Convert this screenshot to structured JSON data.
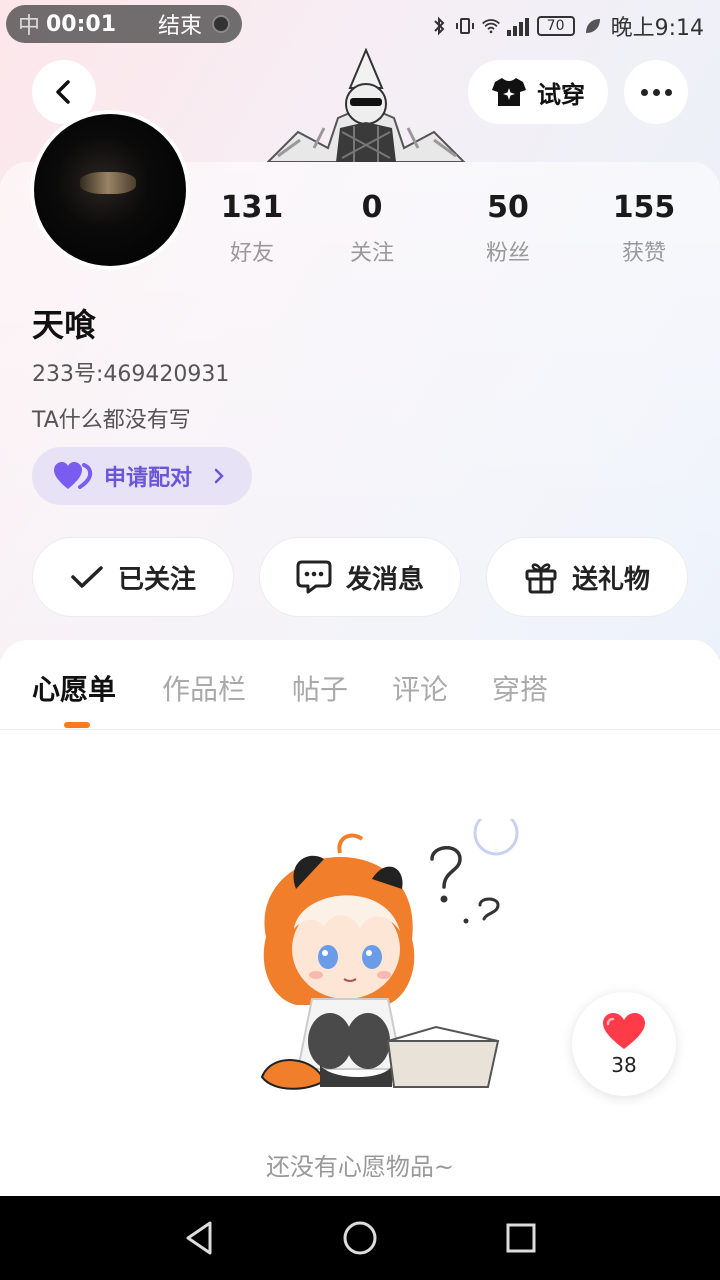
{
  "status_bar": {
    "carrier": "中",
    "rec_time": "00:01",
    "rec_end": "结束",
    "battery": "70",
    "clock": "晚上9:14"
  },
  "header": {
    "tryon_label": "试穿"
  },
  "stats": [
    {
      "value": "131",
      "label": "好友"
    },
    {
      "value": "0",
      "label": "关注"
    },
    {
      "value": "50",
      "label": "粉丝"
    },
    {
      "value": "155",
      "label": "获赞"
    }
  ],
  "profile": {
    "name": "天喰",
    "uid": "233号:469420931",
    "bio": "TA什么都没有写",
    "pair_label": "申请配对"
  },
  "actions": {
    "follow_label": "已关注",
    "message_label": "发消息",
    "gift_label": "送礼物"
  },
  "tabs": [
    {
      "label": "心愿单",
      "active": true
    },
    {
      "label": "作品栏",
      "active": false
    },
    {
      "label": "帖子",
      "active": false
    },
    {
      "label": "评论",
      "active": false
    },
    {
      "label": "穿搭",
      "active": false
    }
  ],
  "empty_state": {
    "message": "还没有心愿物品~"
  },
  "like_float": {
    "count": "38"
  },
  "colors": {
    "accent_orange": "#ff7a1a",
    "pair_purple": "#6c55d8",
    "pair_bg": "#e7e2f6",
    "heart_red": "#ff3b4a"
  }
}
